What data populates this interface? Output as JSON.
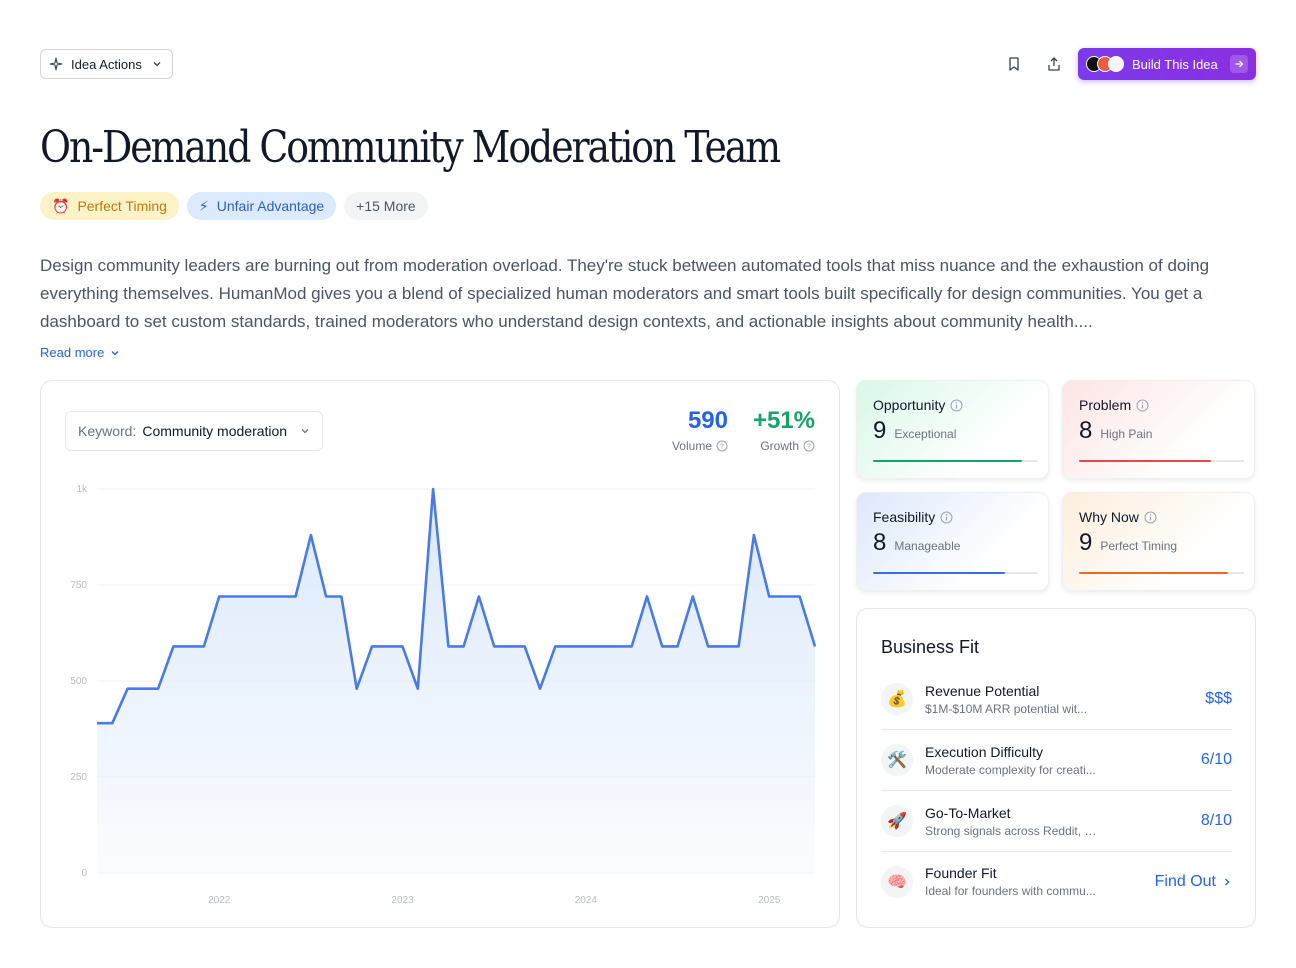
{
  "toolbar": {
    "idea_actions_label": "Idea Actions",
    "build_label": "Build This Idea"
  },
  "idea": {
    "title": "On-Demand Community Moderation Team",
    "tags": [
      {
        "label": "Perfect Timing",
        "icon": "⏰"
      },
      {
        "label": "Unfair Advantage",
        "icon": "⚡"
      },
      {
        "label": "+15 More"
      }
    ],
    "description": "Design community leaders are burning out from moderation overload. They're stuck between automated tools that miss nuance and the exhaustion of doing everything themselves. HumanMod gives you a blend of specialized human moderators and smart tools built specifically for design communities. You get a dashboard to set custom standards, trained moderators who understand design contexts, and actionable insights about community health....",
    "read_more_label": "Read more"
  },
  "trend": {
    "keyword_label": "Keyword:",
    "keyword_value": "Community moderation",
    "volume_value": "590",
    "volume_label": "Volume",
    "growth_value": "+51%",
    "growth_label": "Growth"
  },
  "chart_data": {
    "type": "area",
    "ylim": [
      0,
      1000
    ],
    "yticks": [
      "1k",
      "750",
      "500",
      "250",
      "0"
    ],
    "ytick_values": [
      1000,
      750,
      500,
      250,
      0
    ],
    "xticks": [
      "2022",
      "2023",
      "2024",
      "2025"
    ],
    "xtick_dates": [
      "2022-01",
      "2023-01",
      "2024-01",
      "2025-01"
    ],
    "x": [
      "2021-05",
      "2021-06",
      "2021-07",
      "2021-08",
      "2021-09",
      "2021-10",
      "2021-11",
      "2021-12",
      "2022-01",
      "2022-02",
      "2022-03",
      "2022-04",
      "2022-05",
      "2022-06",
      "2022-07",
      "2022-08",
      "2022-09",
      "2022-10",
      "2022-11",
      "2022-12",
      "2023-01",
      "2023-02",
      "2023-03",
      "2023-04",
      "2023-05",
      "2023-06",
      "2023-07",
      "2023-08",
      "2023-09",
      "2023-10",
      "2023-11",
      "2023-12",
      "2024-01",
      "2024-02",
      "2024-03",
      "2024-04",
      "2024-05",
      "2024-06",
      "2024-07",
      "2024-08",
      "2024-09",
      "2024-10",
      "2024-11",
      "2024-12",
      "2025-01",
      "2025-02",
      "2025-03",
      "2025-04"
    ],
    "values": [
      390,
      390,
      480,
      480,
      480,
      590,
      590,
      590,
      720,
      720,
      720,
      720,
      720,
      720,
      880,
      720,
      720,
      480,
      590,
      590,
      590,
      480,
      1000,
      590,
      590,
      720,
      590,
      590,
      590,
      480,
      590,
      590,
      590,
      590,
      590,
      590,
      720,
      590,
      590,
      720,
      590,
      590,
      590,
      880,
      720,
      720,
      720,
      590
    ],
    "line_color": "#4a7ae6",
    "fill_color": "#dbe9fb"
  },
  "scores": [
    {
      "title": "Opportunity",
      "value": "9",
      "label": "Exceptional",
      "fraction": 0.9,
      "color": "#16a36b"
    },
    {
      "title": "Problem",
      "value": "8",
      "label": "High Pain",
      "fraction": 0.8,
      "color": "#e5484d"
    },
    {
      "title": "Feasibility",
      "value": "8",
      "label": "Manageable",
      "fraction": 0.8,
      "color": "#3b6fe0"
    },
    {
      "title": "Why Now",
      "value": "9",
      "label": "Perfect Timing",
      "fraction": 0.9,
      "color": "#ea6a1f"
    }
  ],
  "business_fit": {
    "title": "Business Fit",
    "items": [
      {
        "icon": "💰",
        "name": "Revenue Potential",
        "desc": "$1M-$10M ARR potential wit...",
        "value": "$$$"
      },
      {
        "icon": "🛠️",
        "name": "Execution Difficulty",
        "desc": "Moderate complexity for creati...",
        "value": "6/10"
      },
      {
        "icon": "🚀",
        "name": "Go-To-Market",
        "desc": "Strong signals across Reddit, F...",
        "value": "8/10"
      },
      {
        "icon": "🧠",
        "name": "Founder Fit",
        "desc": "Ideal for founders with commu...",
        "value": "Find Out"
      }
    ]
  }
}
